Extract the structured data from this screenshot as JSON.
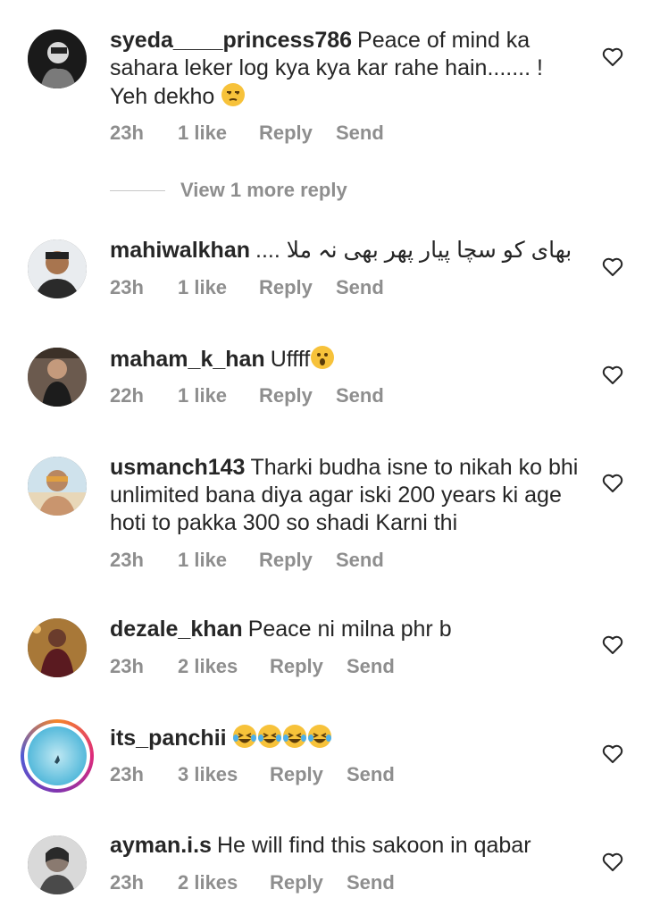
{
  "comments": [
    {
      "username": "syeda____princess786",
      "text": "Peace of mind ka sahara leker log kya kya kar rahe hain....... ! Yeh dekho",
      "emoji": "unamused-face",
      "time": "23h",
      "likes": "1 like",
      "reply": "Reply",
      "send": "Send"
    },
    {
      "username": "mahiwalkhan",
      "text": "بھای کو سچا پیار پھر بھی نہ ملا ....",
      "time": "23h",
      "likes": "1 like",
      "reply": "Reply",
      "send": "Send"
    },
    {
      "username": "maham_k_han",
      "text": "Uffff",
      "emoji": "surprised-face",
      "time": "22h",
      "likes": "1 like",
      "reply": "Reply",
      "send": "Send"
    },
    {
      "username": "usmanch143",
      "text": "Tharki budha isne to nikah ko bhi unlimited bana diya agar iski 200 years ki age hoti to pakka 300 so shadi Karni thi",
      "time": "23h",
      "likes": "1 like",
      "reply": "Reply",
      "send": "Send"
    },
    {
      "username": "dezale_khan",
      "text": "Peace ni milna phr b",
      "time": "23h",
      "likes": "2 likes",
      "reply": "Reply",
      "send": "Send"
    },
    {
      "username": "its_panchii",
      "text": "",
      "emoji": "laughing-tears-face x4",
      "time": "23h",
      "likes": "3 likes",
      "reply": "Reply",
      "send": "Send"
    },
    {
      "username": "ayman.i.s",
      "text": "He will find this sakoon in qabar",
      "time": "23h",
      "likes": "2 likes",
      "reply": "Reply",
      "send": "Send"
    }
  ],
  "view_more_replies": "View 1 more reply",
  "colors": {
    "text": "#262626",
    "meta": "#8e8e8e",
    "divider": "#c7c7c7",
    "heart": "#262626"
  }
}
